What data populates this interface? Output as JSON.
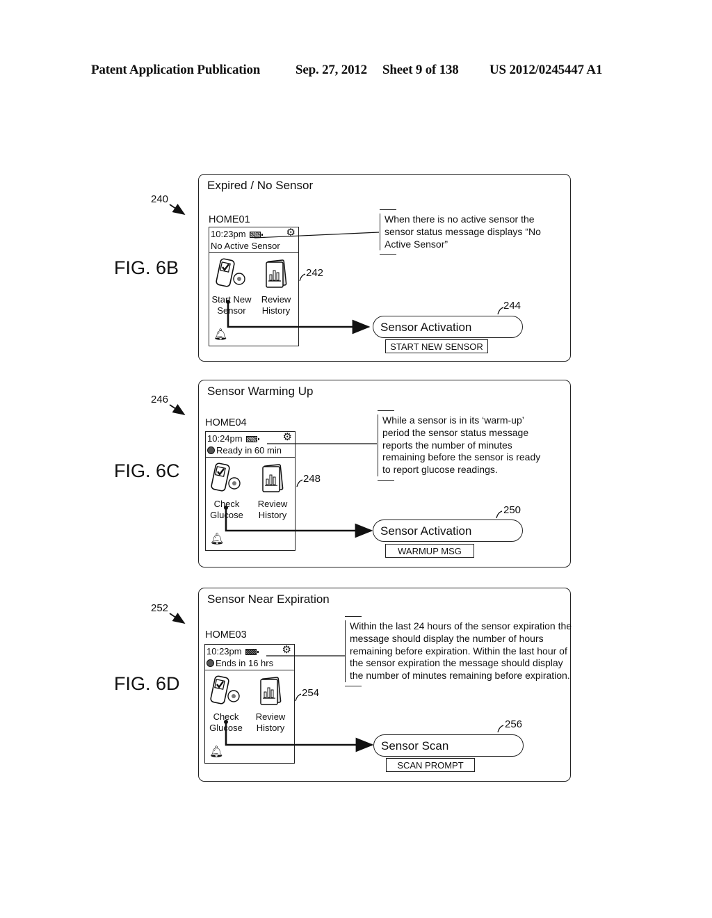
{
  "header": {
    "publication": "Patent Application Publication",
    "date": "Sep. 27, 2012",
    "sheet": "Sheet 9 of 138",
    "number": "US 2012/0245447 A1"
  },
  "figures": [
    {
      "fig_label": "FIG. 6B",
      "ref_panel": "240",
      "ref_device": "242",
      "ref_pill": "244",
      "title": "Expired / No Sensor",
      "screen_id": "HOME01",
      "status_time": "10:23pm",
      "status_message": "No Active Sensor",
      "status_has_sensor_icon": false,
      "app_left": "Start New Sensor",
      "app_right": "Review History",
      "callout": "When there is no active sensor the sensor status message displays “No Active Sensor”",
      "pill_label": "Sensor Activation",
      "tag_label": "START NEW SENSOR",
      "icons": [
        "battery-icon",
        "gear-icon",
        "meter-icon",
        "history-book-icon",
        "bell-icon"
      ]
    },
    {
      "fig_label": "FIG. 6C",
      "ref_panel": "246",
      "ref_device": "248",
      "ref_pill": "250",
      "title": "Sensor Warming Up",
      "screen_id": "HOME04",
      "status_time": "10:24pm",
      "status_message": "Ready in 60 min",
      "status_has_sensor_icon": true,
      "app_left": "Check Glucose",
      "app_right": "Review History",
      "callout": "While a sensor is in its ‘warm-up’ period the sensor status message reports the number of minutes remaining before the sensor is ready to report glucose readings.",
      "pill_label": "Sensor Activation",
      "tag_label": "WARMUP MSG",
      "icons": [
        "battery-icon",
        "gear-icon",
        "sensor-icon",
        "meter-icon",
        "history-book-icon",
        "bell-icon"
      ]
    },
    {
      "fig_label": "FIG. 6D",
      "ref_panel": "252",
      "ref_device": "254",
      "ref_pill": "256",
      "title": "Sensor Near Expiration",
      "screen_id": "HOME03",
      "status_time": "10:23pm",
      "status_message": "Ends in 16 hrs",
      "status_has_sensor_icon": true,
      "app_left": "Check Glucose",
      "app_right": "Review History",
      "callout": "Within the last 24 hours of the sensor expiration the message should display the number of hours remaining before expiration. Within the last hour of the sensor expiration the message should display the number of minutes remaining before expiration.",
      "pill_label": "Sensor Scan",
      "tag_label": "SCAN PROMPT",
      "icons": [
        "battery-icon",
        "gear-icon",
        "sensor-icon",
        "meter-icon",
        "history-book-icon",
        "bell-icon"
      ]
    }
  ]
}
